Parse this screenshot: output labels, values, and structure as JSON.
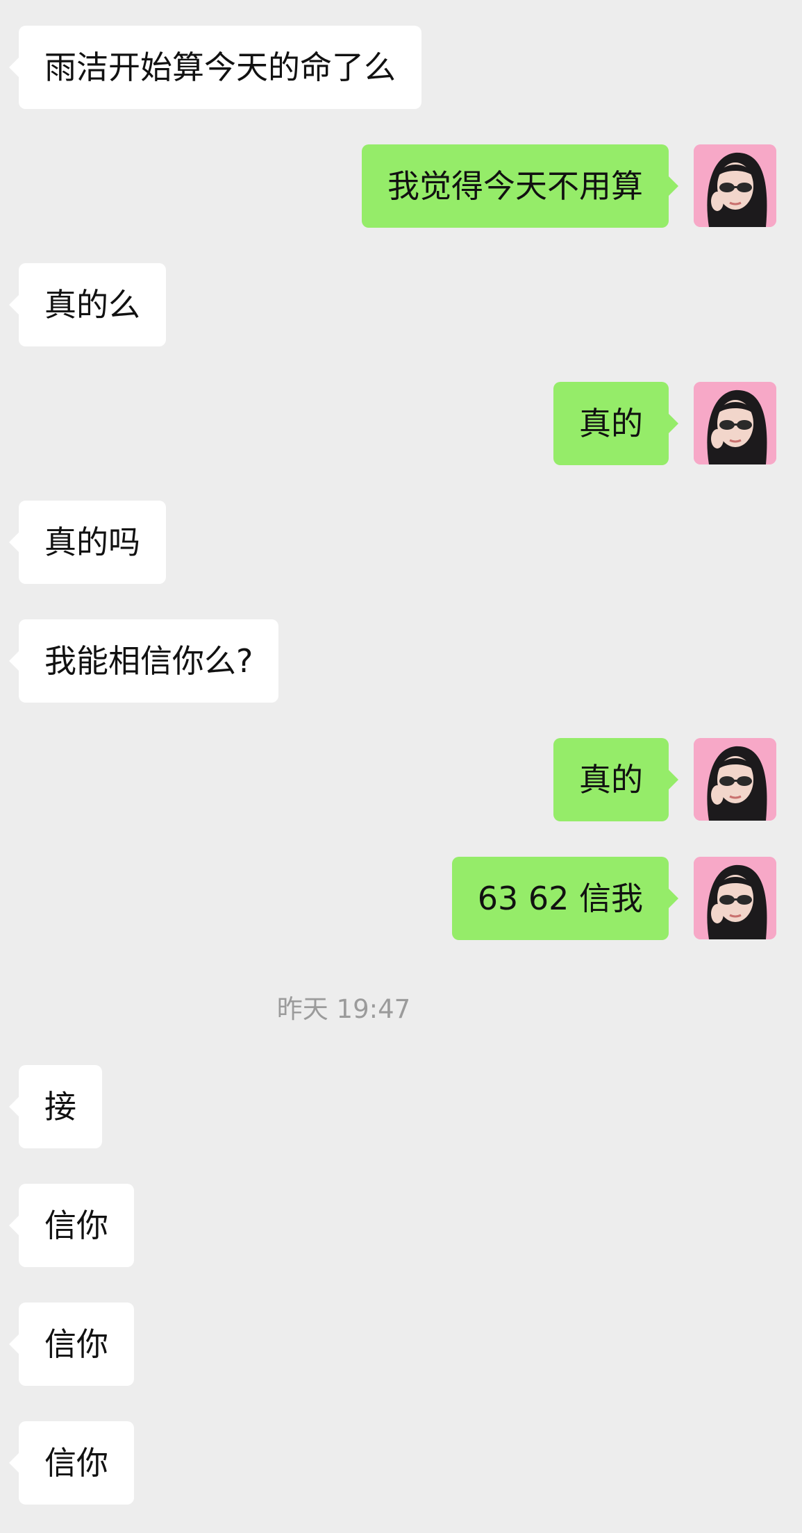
{
  "accent_colors": {
    "background": "#ededed",
    "incoming_bubble": "#ffffff",
    "outgoing_bubble": "#95ec69",
    "avatar_background": "#f7a8c7",
    "timestamp_text": "#9b9b9b"
  },
  "avatar": {
    "icon": "user-avatar-photo"
  },
  "messages_before": [
    {
      "from": "other",
      "text": "雨洁开始算今天的命了么"
    },
    {
      "from": "me",
      "text": "我觉得今天不用算"
    },
    {
      "from": "other",
      "text": "真的么"
    },
    {
      "from": "me",
      "text": "真的"
    },
    {
      "from": "other",
      "text": "真的吗"
    },
    {
      "from": "other",
      "text": "我能相信你么?"
    },
    {
      "from": "me",
      "text": "真的"
    },
    {
      "from": "me",
      "text": "63 62 信我"
    }
  ],
  "timestamp": "昨天 19:47",
  "messages_after": [
    {
      "from": "other",
      "text": "接"
    },
    {
      "from": "other",
      "text": "信你"
    },
    {
      "from": "other",
      "text": "信你"
    },
    {
      "from": "other",
      "text": "信你"
    }
  ]
}
